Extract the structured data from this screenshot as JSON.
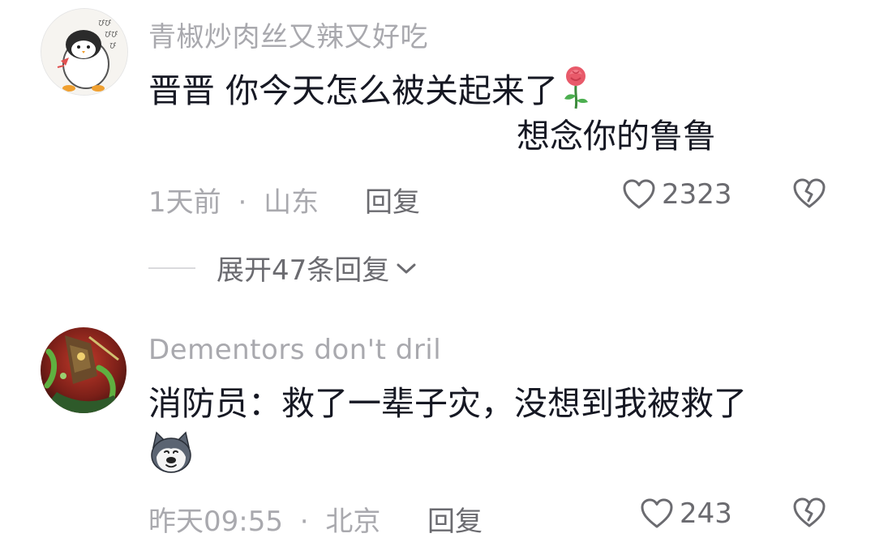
{
  "comments": [
    {
      "username": "青椒炒肉丝又辣又好吃",
      "line1": "晋晋 你今天怎么被关起来了",
      "line1_emoji": "rose-emoji",
      "line2": "想念你的鲁鲁",
      "time": "1天前",
      "separator": "·",
      "location": "山东",
      "reply_label": "回复",
      "likes": "2323",
      "avatar": "penguin-avatar-icon"
    },
    {
      "username": "Dementors don't dril",
      "line1": "消防员：救了一辈子灾，没想到我被救了",
      "line2_emoji": "husky-dog-emoji",
      "time": "昨天09:55",
      "separator": "·",
      "location": "北京",
      "reply_label": "回复",
      "likes": "243",
      "avatar": "game-character-avatar-icon"
    }
  ],
  "expand_replies": {
    "label": "展开47条回复",
    "icon": "chevron-down-icon"
  },
  "colors": {
    "primary_text": "#161823",
    "secondary_text": "#a9a9ae",
    "action_text": "#6b6b70"
  }
}
